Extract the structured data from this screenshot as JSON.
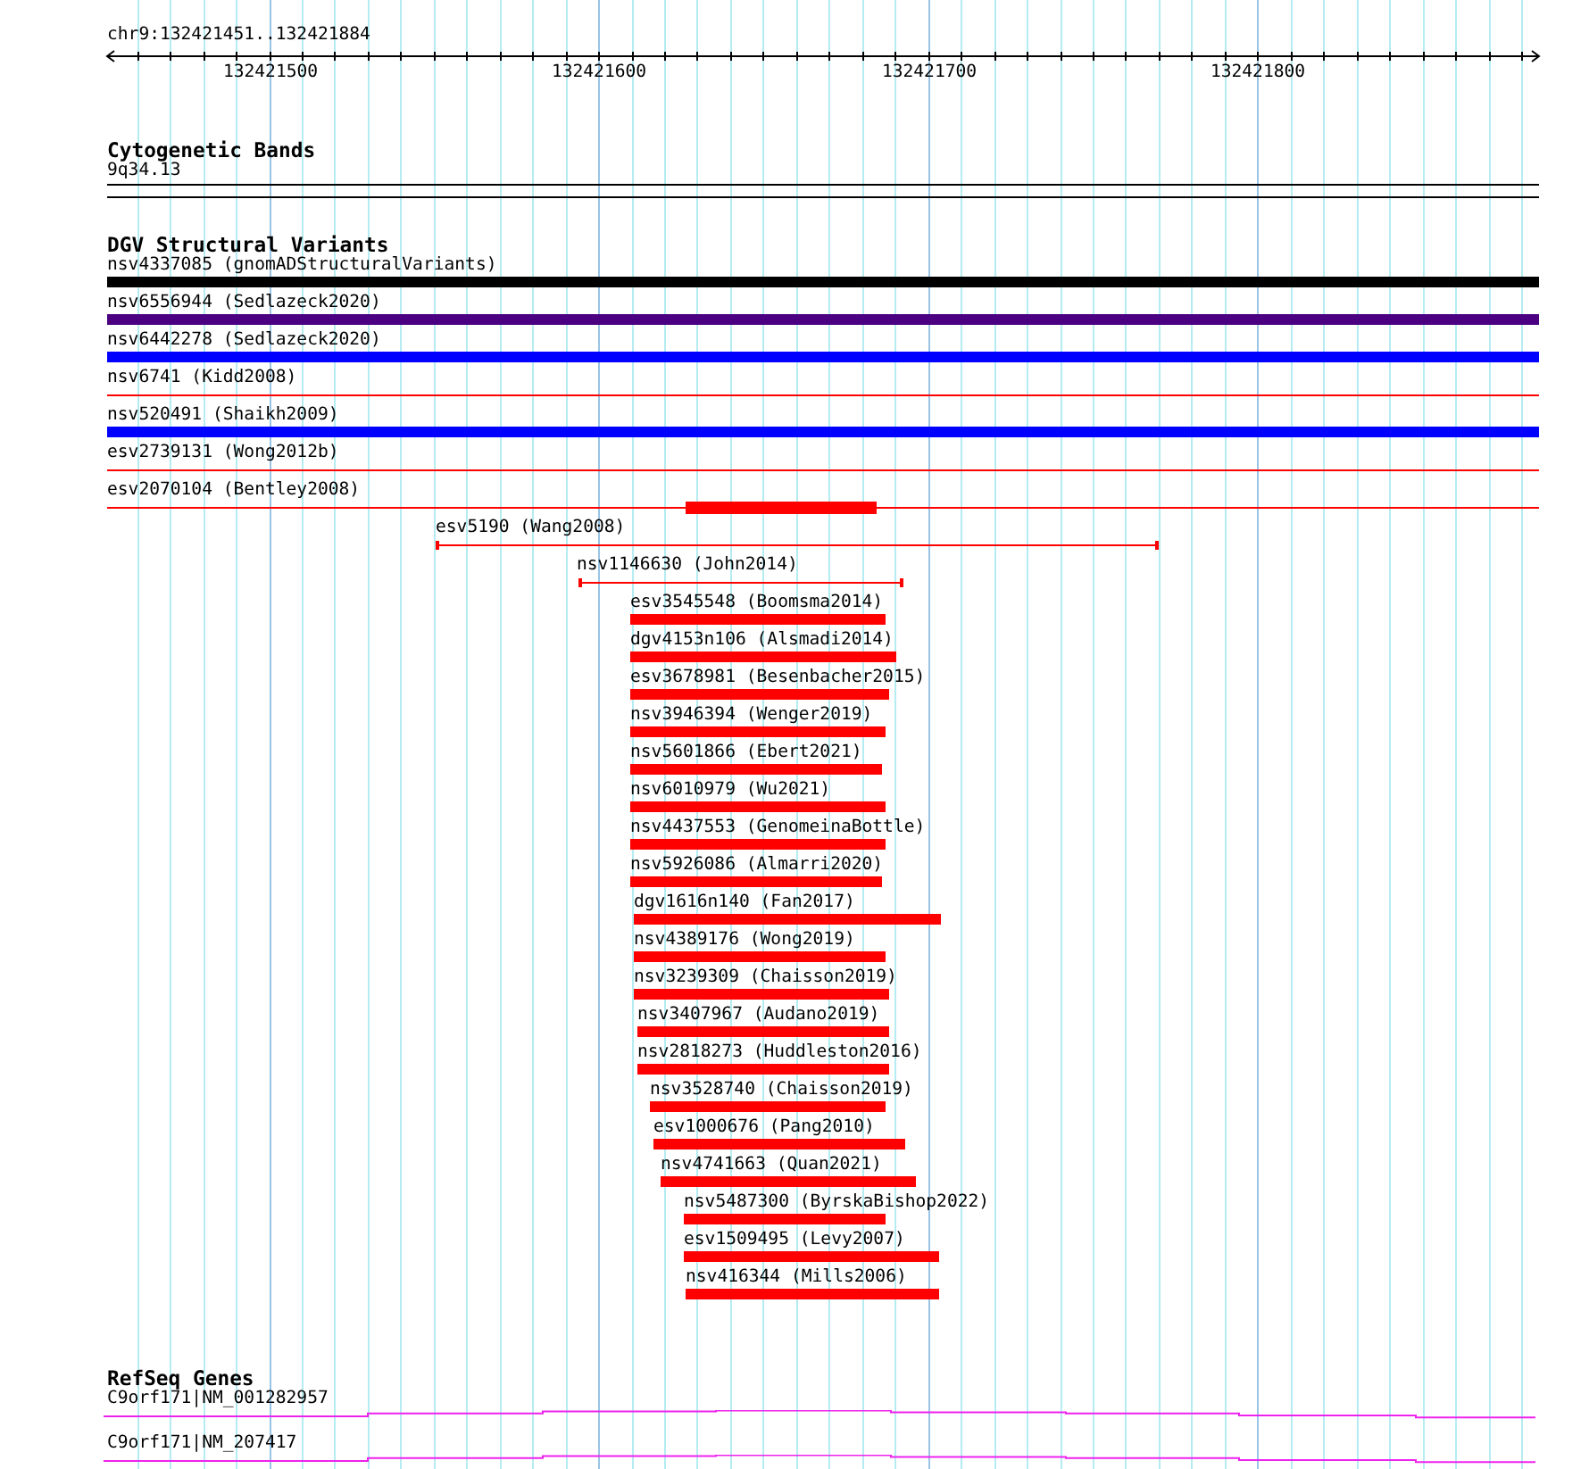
{
  "position_label": "chr9:132421451..132421884",
  "ruler": {
    "tick_labels": [
      "132421500",
      "132421600",
      "132421700",
      "132421800"
    ]
  },
  "tracks": [
    {
      "kind": "cytoband",
      "title": "Cytogenetic Bands",
      "items": [
        {
          "label": "9q34.13"
        }
      ]
    },
    {
      "kind": "variants",
      "title": "DGV Structural Variants",
      "items": [
        {
          "label": "nsv4337085 (gnomADStructuralVariants)",
          "kind": "thick",
          "color": "#000000"
        },
        {
          "label": "nsv6556944 (Sedlazeck2020)",
          "kind": "thick",
          "color": "#4b0082"
        },
        {
          "label": "nsv6442278 (Sedlazeck2020)",
          "kind": "thick",
          "color": "#0000ff"
        },
        {
          "label": "nsv6741 (Kidd2008)",
          "kind": "thin",
          "color": "#ff0000"
        },
        {
          "label": "nsv520491 (Shaikh2009)",
          "kind": "thick",
          "color": "#0000ff"
        },
        {
          "label": "esv2739131 (Wong2012b)",
          "kind": "thin",
          "color": "#ff0000"
        },
        {
          "label": "esv2070104 (Bentley2008)",
          "kind": "thin-thick",
          "color": "#ff0000"
        },
        {
          "label": "esv5190 (Wang2008)",
          "kind": "span",
          "color": "#ff0000"
        },
        {
          "label": "nsv1146630 (John2014)",
          "kind": "span",
          "color": "#ff0000"
        },
        {
          "label": "esv3545548 (Boomsma2014)",
          "kind": "thick",
          "color": "#ff0000"
        },
        {
          "label": "dgv4153n106 (Alsmadi2014)",
          "kind": "thick",
          "color": "#ff0000"
        },
        {
          "label": "esv3678981 (Besenbacher2015)",
          "kind": "thick",
          "color": "#ff0000"
        },
        {
          "label": "nsv3946394 (Wenger2019)",
          "kind": "thick",
          "color": "#ff0000"
        },
        {
          "label": "nsv5601866 (Ebert2021)",
          "kind": "thick",
          "color": "#ff0000"
        },
        {
          "label": "nsv6010979 (Wu2021)",
          "kind": "thick",
          "color": "#ff0000"
        },
        {
          "label": "nsv4437553 (GenomeinaBottle)",
          "kind": "thick",
          "color": "#ff0000"
        },
        {
          "label": "nsv5926086 (Almarri2020)",
          "kind": "thick",
          "color": "#ff0000"
        },
        {
          "label": "dgv1616n140 (Fan2017)",
          "kind": "thick",
          "color": "#ff0000"
        },
        {
          "label": "nsv4389176 (Wong2019)",
          "kind": "thick",
          "color": "#ff0000"
        },
        {
          "label": "nsv3239309 (Chaisson2019)",
          "kind": "thick",
          "color": "#ff0000"
        },
        {
          "label": "nsv3407967 (Audano2019)",
          "kind": "thick",
          "color": "#ff0000"
        },
        {
          "label": "nsv2818273 (Huddleston2016)",
          "kind": "thick",
          "color": "#ff0000"
        },
        {
          "label": "nsv3528740 (Chaisson2019)",
          "kind": "thick",
          "color": "#ff0000"
        },
        {
          "label": "esv1000676 (Pang2010)",
          "kind": "thick",
          "color": "#ff0000"
        },
        {
          "label": "nsv4741663 (Quan2021)",
          "kind": "thick",
          "color": "#ff0000"
        },
        {
          "label": "nsv5487300 (ByrskaBishop2022)",
          "kind": "thick",
          "color": "#ff0000"
        },
        {
          "label": "esv1509495 (Levy2007)",
          "kind": "thick",
          "color": "#ff0000"
        },
        {
          "label": "nsv416344 (Mills2006)",
          "kind": "thick",
          "color": "#ff0000"
        }
      ]
    },
    {
      "kind": "genes",
      "title": "RefSeq Genes",
      "items": [
        {
          "label": "C9orf171|NM_001282957"
        },
        {
          "label": "C9orf171|NM_207417"
        }
      ]
    }
  ]
}
